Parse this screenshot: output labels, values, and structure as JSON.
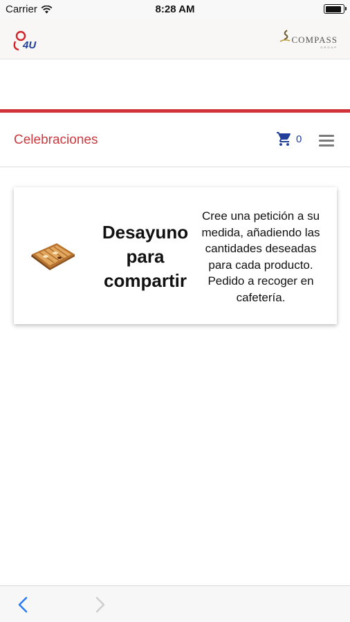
{
  "status_bar": {
    "carrier": "Carrier",
    "time": "8:28 AM",
    "battery_level": 0.95,
    "wifi_icon": "wifi-icon",
    "battery_icon": "battery-icon"
  },
  "header": {
    "left_logo": "4U",
    "right_logo": {
      "brand": "COMPASS",
      "sub": "GROUP"
    }
  },
  "nav": {
    "title": "Celebraciones",
    "cart_count": "0",
    "cart_icon": "cart-icon",
    "menu_icon": "hamburger-menu-icon"
  },
  "product": {
    "title": "Desayuno para compartir",
    "description": "Cree una petición a su medida, añadiendo las cantidades deseadas para cada producto. Pedido a recoger en cafetería.",
    "image": "pastry-tray-image"
  },
  "toolbar": {
    "back_icon": "chevron-left-icon",
    "forward_icon": "chevron-right-icon"
  },
  "colors": {
    "accent_red": "#d0323a",
    "title_red": "#cc3a3f",
    "cart_blue": "#1f3f9a",
    "nav_blue": "#2a7cf6"
  }
}
